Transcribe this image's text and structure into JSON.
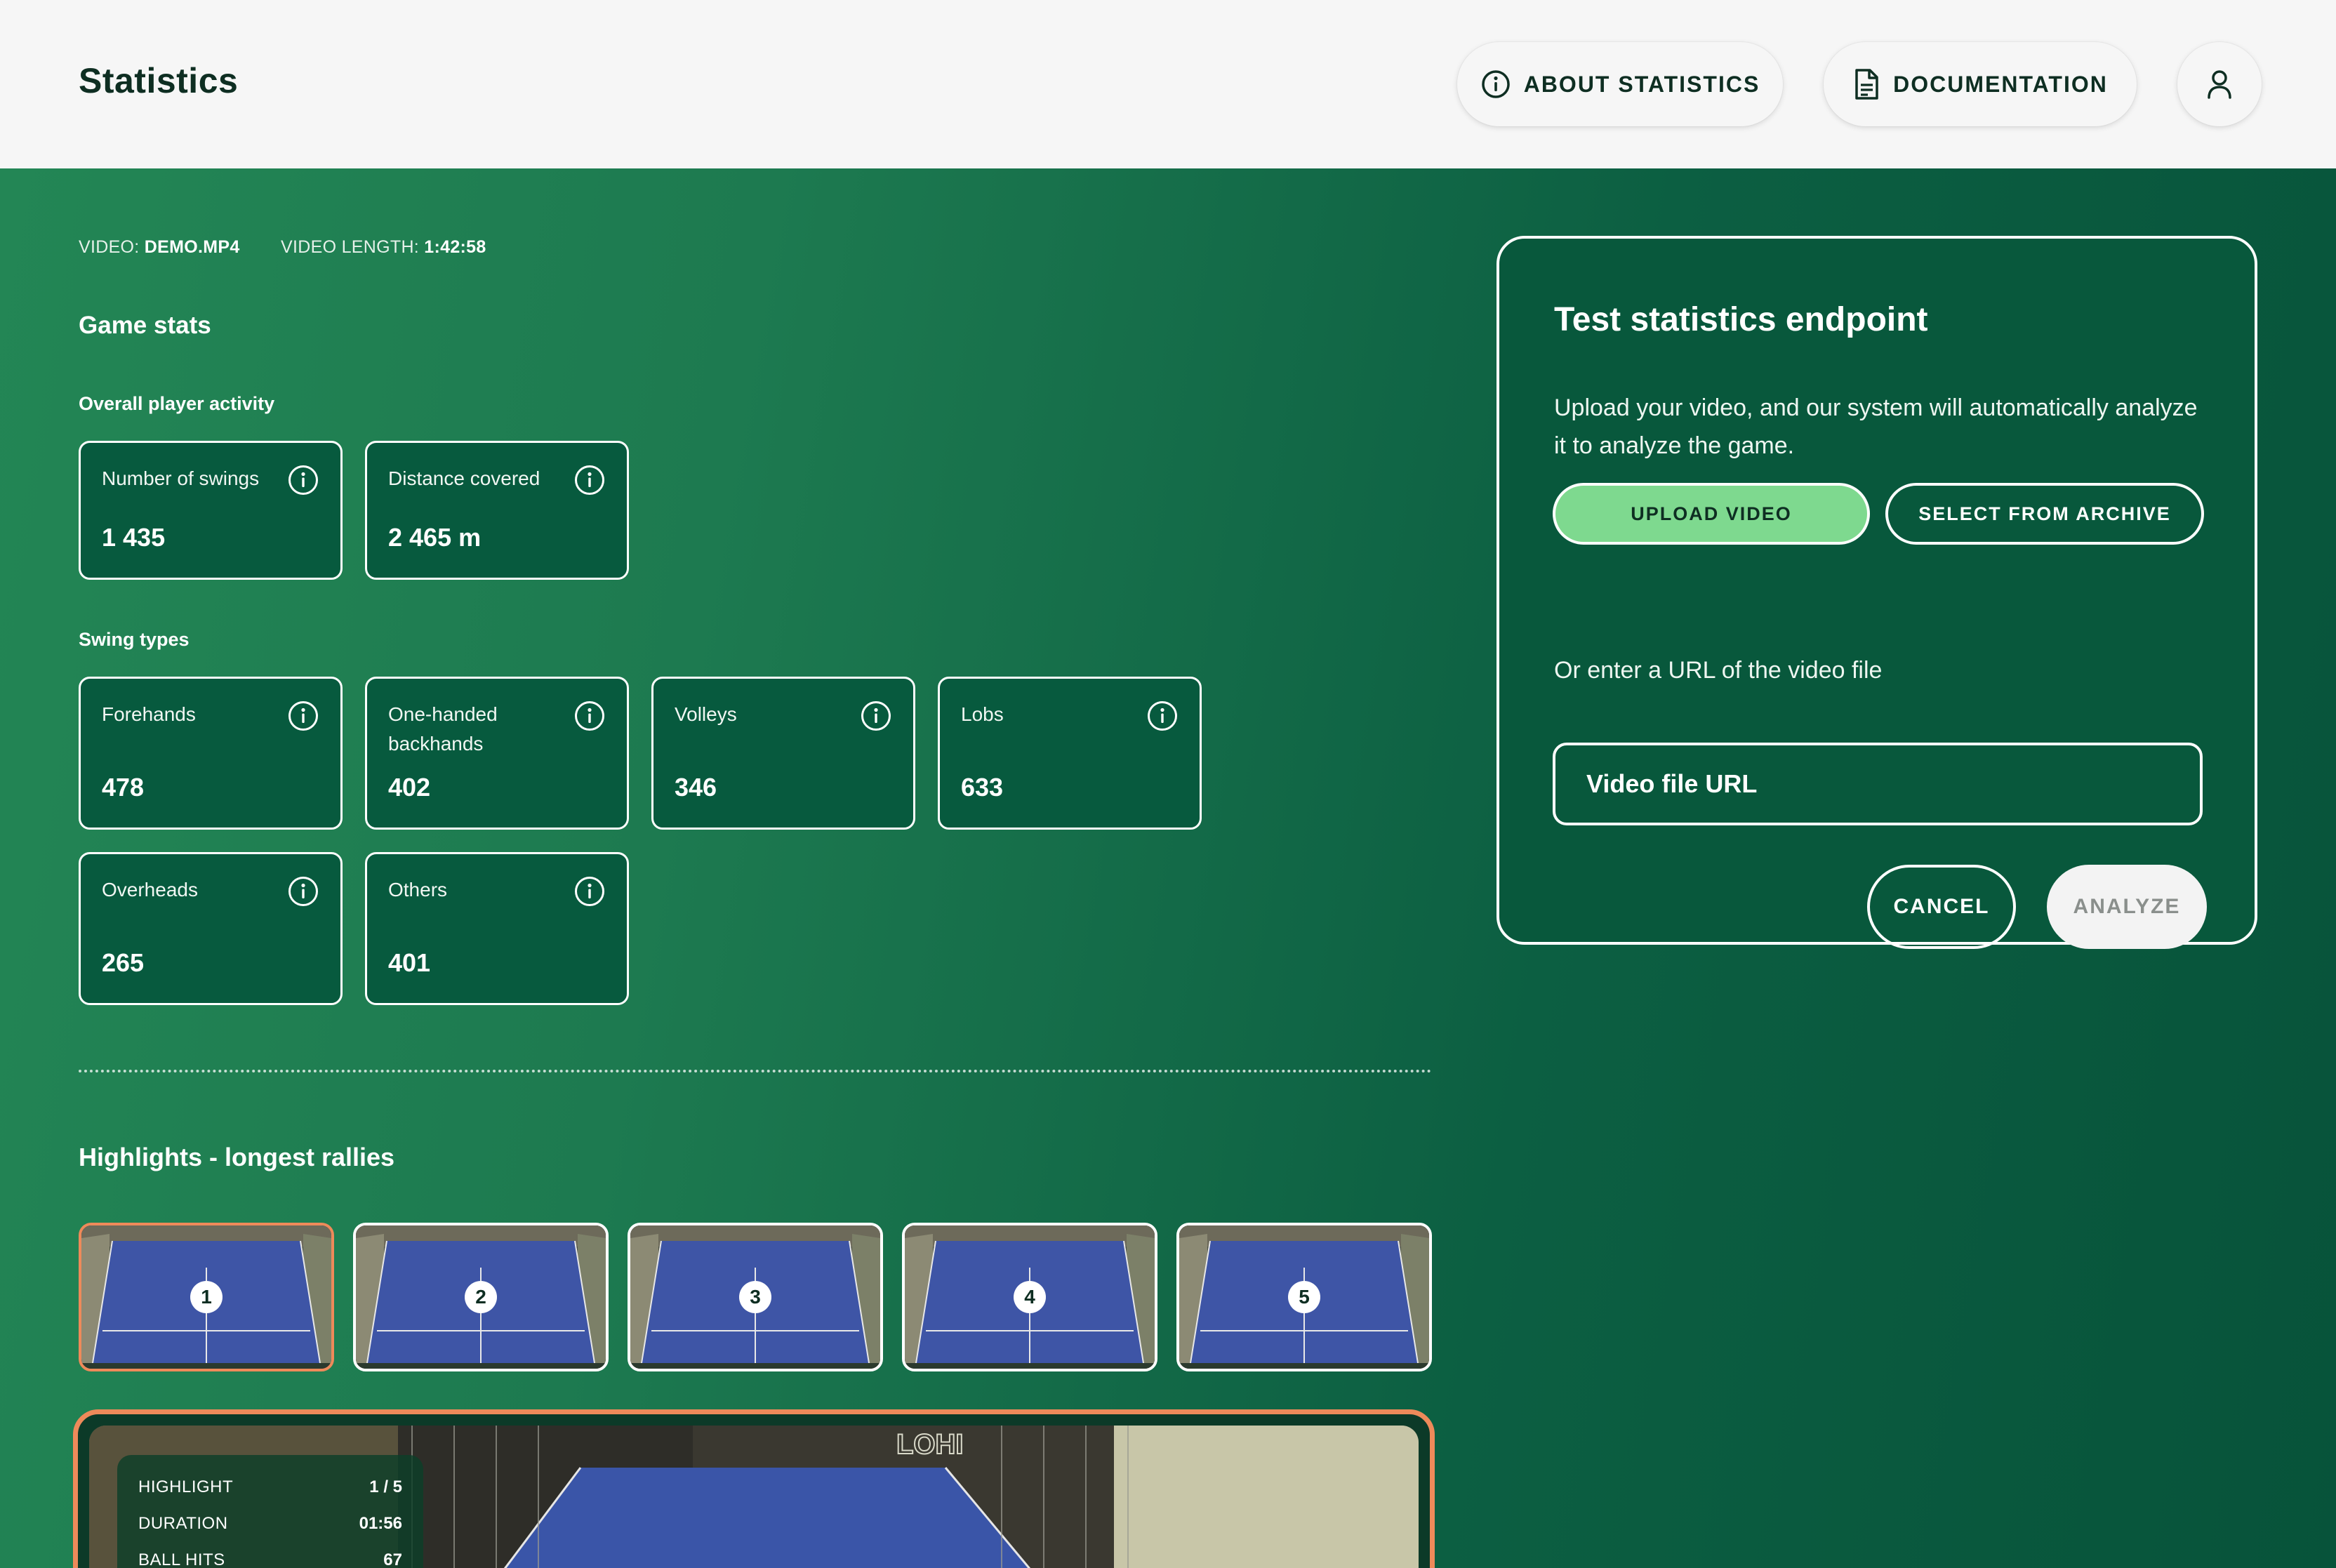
{
  "header": {
    "title": "Statistics",
    "about_label": "ABOUT STATISTICS",
    "docs_label": "DOCUMENTATION",
    "icons": {
      "about": "info-icon",
      "docs": "document-icon",
      "profile": "user-icon"
    }
  },
  "video_meta": {
    "video_key": "VIDEO:",
    "video_value": "DEMO.MP4",
    "length_key": "VIDEO LENGTH:",
    "length_value": "1:42:58"
  },
  "game_stats": {
    "heading": "Game stats",
    "overall": {
      "heading": "Overall player activity",
      "cards": [
        {
          "label": "Number of swings",
          "value": "1 435"
        },
        {
          "label": "Distance covered",
          "value": "2 465 m"
        }
      ]
    },
    "swing_types": {
      "heading": "Swing types",
      "cards": [
        {
          "label": "Forehands",
          "value": "478"
        },
        {
          "label": "One-handed backhands",
          "value": "402"
        },
        {
          "label": "Volleys",
          "value": "346"
        },
        {
          "label": "Lobs",
          "value": "633"
        },
        {
          "label": "Overheads",
          "value": "265"
        },
        {
          "label": "Others",
          "value": "401"
        }
      ]
    }
  },
  "highlights": {
    "heading": "Highlights - longest rallies",
    "thumbnails": [
      "1",
      "2",
      "3",
      "4",
      "5"
    ],
    "active_index": 0,
    "overlay": {
      "highlight_key": "HIGHLIGHT",
      "highlight_value": "1 / 5",
      "duration_key": "DURATION",
      "duration_value": "01:56",
      "hits_key": "BALL HITS",
      "hits_value": "67"
    }
  },
  "panel": {
    "title": "Test statistics endpoint",
    "description": "Upload your video, and our system will automatically analyze it to analyze the game.",
    "upload_label": "UPLOAD VIDEO",
    "archive_label": "SELECT FROM ARCHIVE",
    "or_url_text": "Or enter a URL of the video file",
    "url_placeholder": "Video file URL",
    "cancel_label": "CANCEL",
    "analyze_label": "ANALYZE"
  },
  "colors": {
    "green_light": "#238655",
    "green_dark": "#07533a",
    "card_bg": "#075a3e",
    "accent_orange": "#ee8a5a",
    "upload_green": "#7ed98f"
  }
}
